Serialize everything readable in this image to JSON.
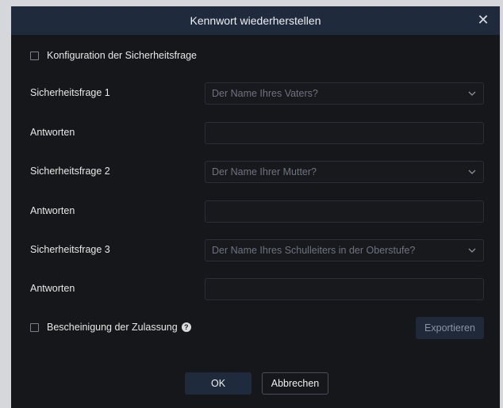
{
  "dialog": {
    "title": "Kennwort wiederherstellen",
    "close_icon": "close-icon"
  },
  "security_config": {
    "label": "Konfiguration der Sicherheitsfrage",
    "checked": false
  },
  "questions": [
    {
      "label": "Sicherheitsfrage 1",
      "selected": "Der Name Ihres Vaters?",
      "answer_label": "Antworten",
      "answer_value": ""
    },
    {
      "label": "Sicherheitsfrage 2",
      "selected": "Der Name Ihrer Mutter?",
      "answer_label": "Antworten",
      "answer_value": ""
    },
    {
      "label": "Sicherheitsfrage 3",
      "selected": "Der Name Ihres Schulleiters in der Oberstufe?",
      "answer_label": "Antworten",
      "answer_value": ""
    }
  ],
  "certificate": {
    "label": "Bescheinigung der Zulassung",
    "checked": false,
    "help_icon": "help-circle-icon"
  },
  "buttons": {
    "export": "Exportieren",
    "ok": "OK",
    "cancel": "Abbrechen"
  },
  "colors": {
    "dialog_bg": "#16171b",
    "titlebar_bg": "#1f2a3c",
    "primary_button": "#1f2a3c"
  }
}
